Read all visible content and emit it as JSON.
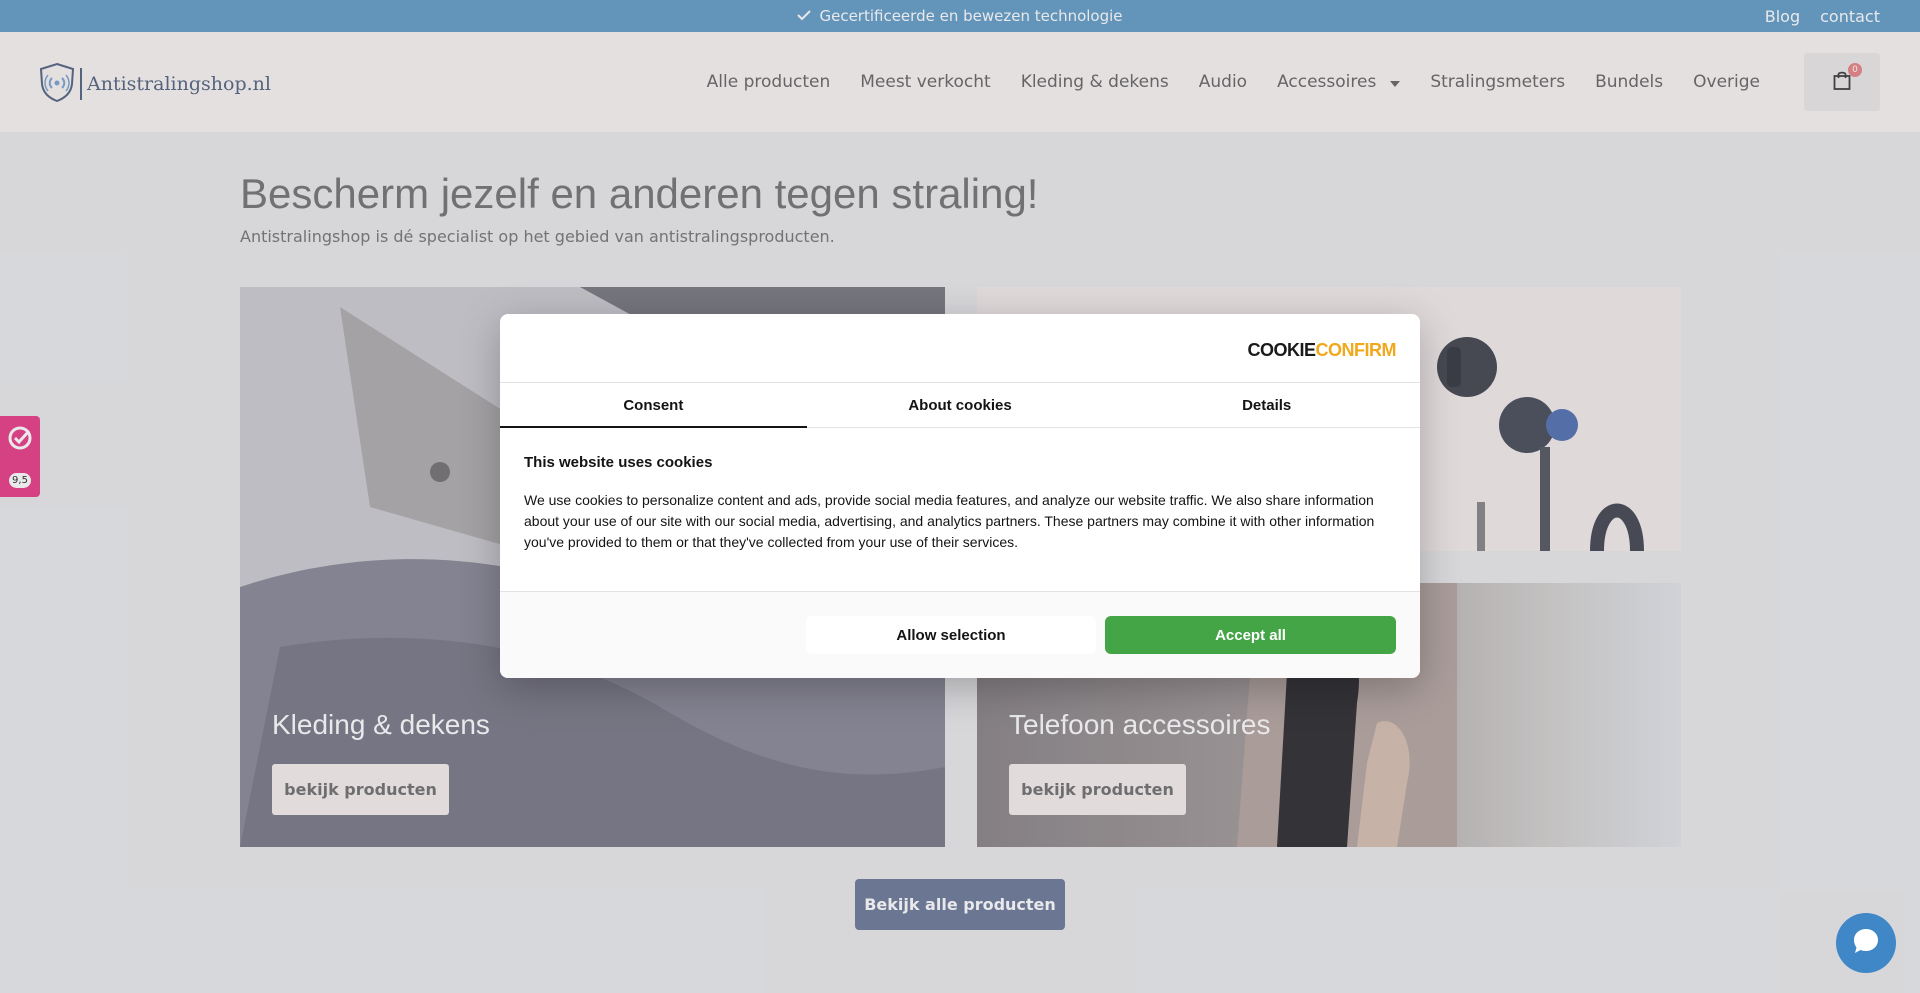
{
  "topbar": {
    "announcement": "Gecertificeerde en bewezen technologie",
    "links": [
      "Blog",
      "contact"
    ]
  },
  "header": {
    "logo_text": "Antistralingshop.nl",
    "nav": [
      "Alle producten",
      "Meest verkocht",
      "Kleding & dekens",
      "Audio",
      "Accessoires",
      "Stralingsmeters",
      "Bundels",
      "Overige"
    ],
    "cart_count": "0"
  },
  "hero": {
    "title": "Bescherm jezelf en anderen tegen straling!",
    "subtitle": "Antistralingshop is dé specialist op het gebied van antistralingsproducten."
  },
  "cards": [
    {
      "title": "Kleding & dekens",
      "button": "bekijk producten"
    },
    {
      "title": "Telefoon accessoires",
      "button": "bekijk producten"
    }
  ],
  "main_button": "Bekijk alle producten",
  "cookie": {
    "brand_part1": "COOKIE",
    "brand_part2": "CONFIRM",
    "tabs": [
      "Consent",
      "About cookies",
      "Details"
    ],
    "heading": "This website uses cookies",
    "body": "We use cookies to personalize content and ads, provide social media features, and analyze our website traffic. We also share information about your use of our site with our social media, advertising, and analytics partners. These partners may combine it with other information you've provided to them or that they've collected from your use of their services.",
    "allow_selection": "Allow selection",
    "accept_all": "Accept all"
  },
  "side_badge": {
    "score": "9,5"
  },
  "colors": {
    "topbar": "#6aa1c9",
    "accept": "#44a547",
    "primary_button": "#737f9e",
    "badge": "#e9458c"
  }
}
